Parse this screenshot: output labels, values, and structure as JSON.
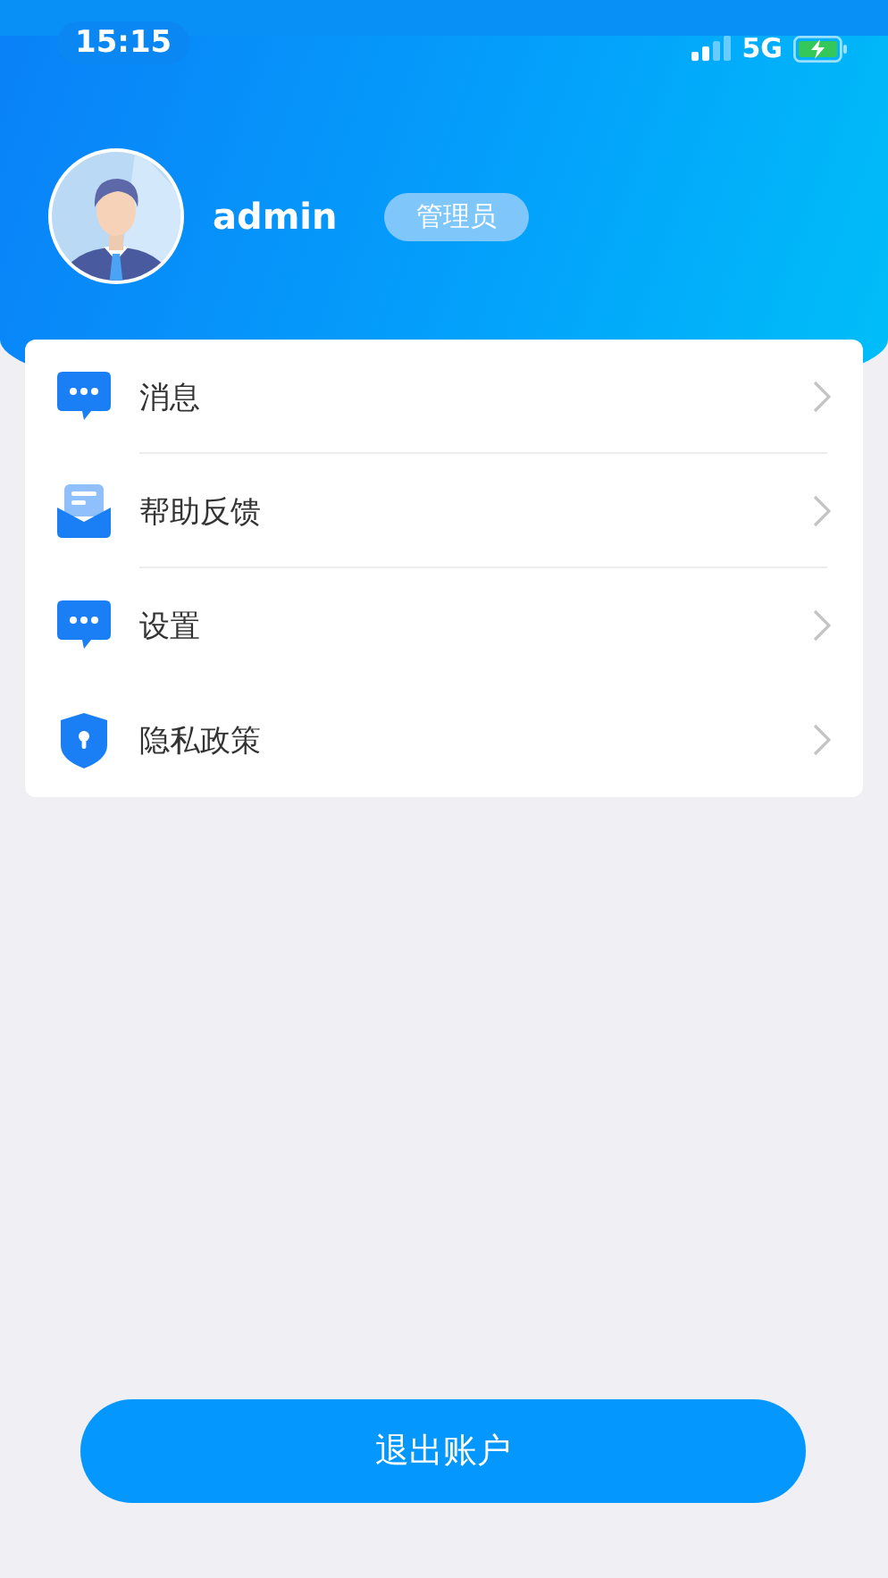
{
  "status_bar": {
    "time": "15:15",
    "network": "5G"
  },
  "profile": {
    "username": "admin",
    "role": "管理员"
  },
  "menu": [
    {
      "label": "消息",
      "kind": "chat",
      "divider": true
    },
    {
      "label": "帮助反馈",
      "kind": "mail",
      "divider": true
    },
    {
      "label": "设置",
      "kind": "chat",
      "divider": false
    },
    {
      "label": "隐私政策",
      "kind": "shield",
      "divider": false
    }
  ],
  "logout_button": "退出账户"
}
